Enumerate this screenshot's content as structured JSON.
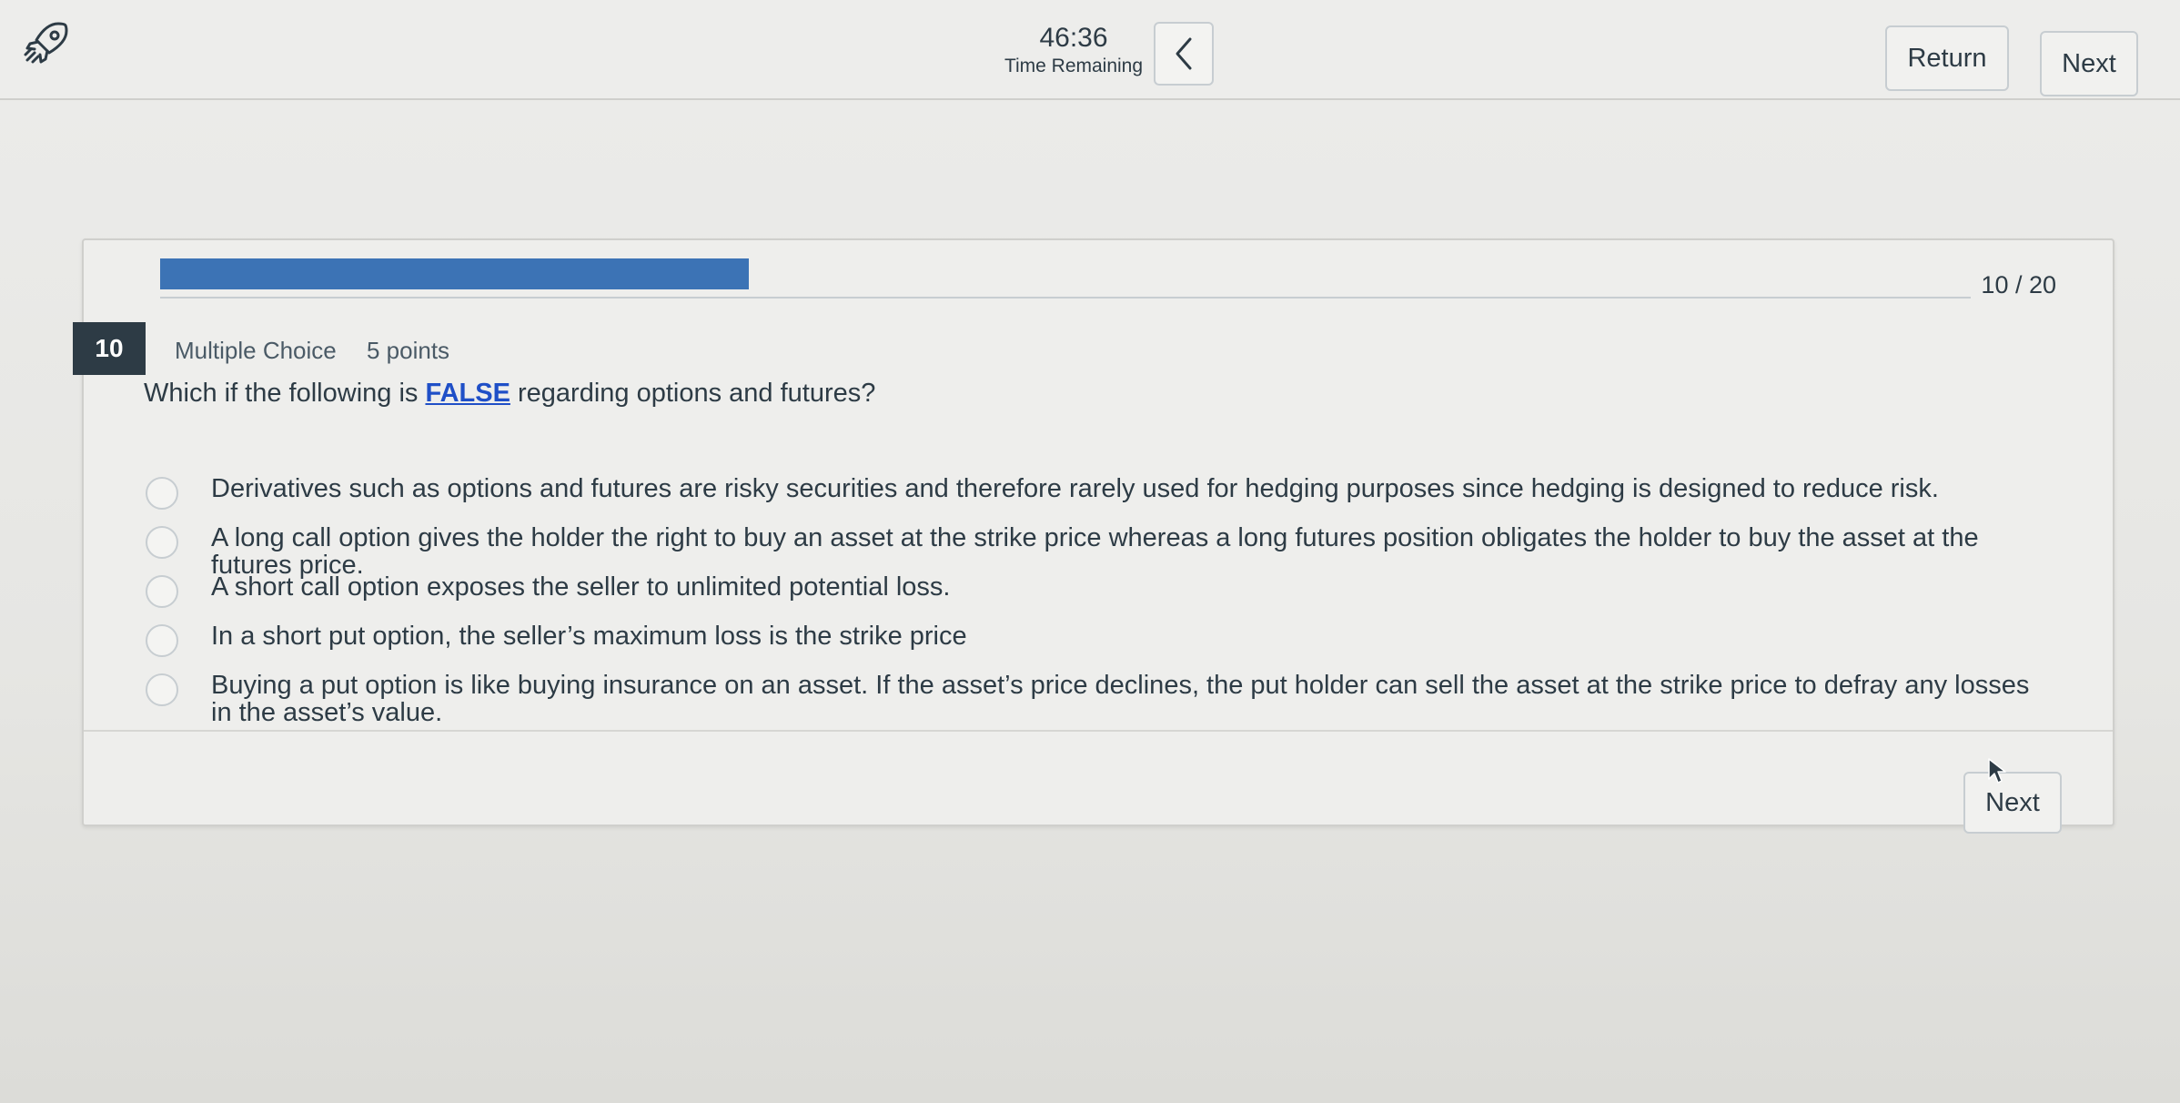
{
  "header": {
    "timer_value": "46:36",
    "timer_label": "Time Remaining",
    "return_label": "Return",
    "next_label": "Next"
  },
  "progress": {
    "current": 10,
    "total": 20,
    "text": "10 / 20",
    "fraction": 0.325
  },
  "question": {
    "number": "10",
    "type": "Multiple Choice",
    "points": "5 points",
    "text_before": "Which if the following is ",
    "text_emphasis": "FALSE",
    "text_after": " regarding options and futures?",
    "answers": [
      "Derivatives such as options and futures are risky securities and therefore rarely used for hedging purposes since hedging is designed to reduce risk.",
      "A long call option gives the holder the right to buy an asset at the strike price whereas a long futures position obligates the holder to buy the asset at the futures price.",
      "A short call option exposes the seller to unlimited potential loss.",
      "In a short put option, the seller’s maximum loss is the strike price",
      "Buying a put option is like buying insurance on an asset. If the asset’s price declines, the put holder can sell the asset at the strike price to defray any losses in the asset’s value."
    ]
  },
  "footer": {
    "next_label": "Next"
  },
  "colors": {
    "progress_fill": "#3c73b5",
    "emphasis_link": "#1f4fc7",
    "question_badge": "#2d3b45"
  },
  "icons": {
    "app_icon": "rocket-icon",
    "collapse_icon": "chevron-left-icon",
    "cursor": "mouse-pointer-icon"
  }
}
